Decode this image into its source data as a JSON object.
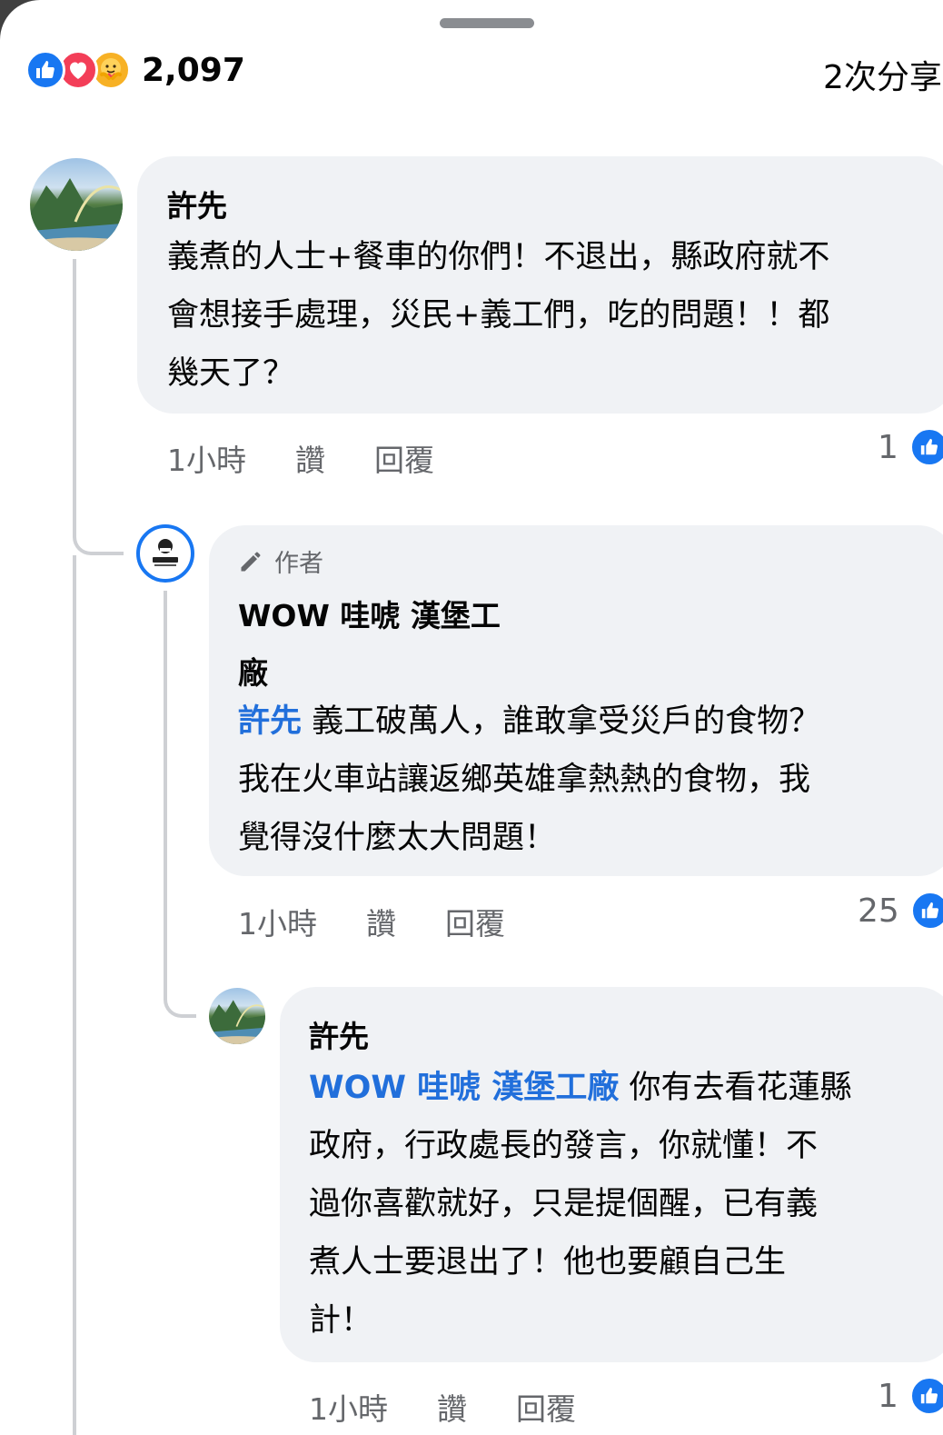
{
  "header": {
    "reaction_count": "2,097",
    "shares": "2次分享"
  },
  "colors": {
    "accent": "#1877f2",
    "mention": "#216fdb",
    "bubble": "#f0f2f5",
    "meta_text": "#65676b"
  },
  "comments": [
    {
      "author": "許先",
      "text": [
        "義煮的人士+餐車的你們！不退出，縣政府就不",
        "會想接手處理，災民+義工們，吃的問題！！都",
        "幾天了？"
      ],
      "time": "1小時",
      "like_label": "讚",
      "reply_label": "回覆",
      "like_count": "1"
    },
    {
      "author_tag": "作者",
      "author": [
        "WOW 哇唬 漢堡工",
        "廠"
      ],
      "mention": "許先",
      "text": [
        " 義工破萬人，誰敢拿受災戶的食物？",
        "我在火車站讓返鄉英雄拿熱熱的食物，我",
        "覺得沒什麼太大問題！"
      ],
      "time": "1小時",
      "like_label": "讚",
      "reply_label": "回覆",
      "like_count": "25"
    },
    {
      "author": "許先",
      "mention": "WOW 哇唬 漢堡工廠",
      "text": [
        " 你有去看花蓮縣",
        "政府，行政處長的發言，你就懂！不",
        "過你喜歡就好，只是提個醒，已有義",
        "煮人士要退出了！他也要顧自己生",
        "計！"
      ],
      "time": "1小時",
      "like_label": "讚",
      "reply_label": "回覆",
      "like_count": "1"
    }
  ]
}
